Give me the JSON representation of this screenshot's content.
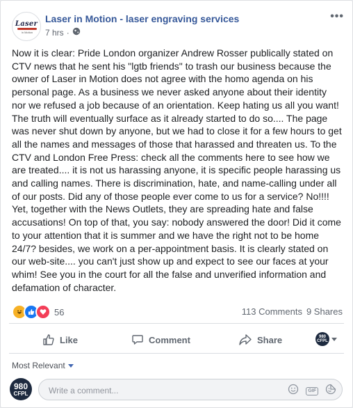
{
  "header": {
    "page_name": "Laser in Motion - laser engraving services",
    "timestamp": "7 hrs",
    "separator": "·",
    "logo_text": "Laser",
    "logo_sub": "in Motion",
    "privacy_icon": "globe-icon",
    "more_icon": "ellipsis-icon",
    "more_label": "•••"
  },
  "post": {
    "text": "Now it is clear: Pride London organizer Andrew Rosser publically stated on CTV news that he sent his \"lgtb friends\" to trash our business because the owner of Laser in Motion does not agree with the homo agenda on his personal page. As a business we never asked anyone about their identity nor we refused a job because of an orientation. Keep hating us all you want! The truth will eventually surface as it already started to do so.... The page was never shut down by anyone, but we had to close it for a few hours to get all the names and messages of those that harassed and threaten us. To the CTV and London Free Press: check all the comments here to see how we are treated.... it is not us harassing anyone, it is specific people harassing us and calling names. There is discrimination, hate, and name-calling under all of our posts. Did any of those people ever come to us for a service? No!!!! Yet, together with the News Outlets, they are spreading hate and false accusations! On top of that, you say: nobody answered the door! Did it come to your attention that it is summer and we have the right not to be home 24/7? besides, we work on a per-appointment basis. It is clearly stated on our web-site.... you can't just show up and expect to see our faces at your whim! See you in the court for all the false and unverified information and defamation of character."
  },
  "reactions": {
    "count": "56",
    "types": [
      "haha-icon",
      "like-icon",
      "love-icon"
    ],
    "comments": "113 Comments",
    "shares": "9 Shares"
  },
  "actions": {
    "like": "Like",
    "comment": "Comment",
    "share": "Share",
    "page_badge_line1": "980",
    "page_badge_line2": "CFPL"
  },
  "comments": {
    "sort_label": "Most Relevant",
    "avatar_line1": "980",
    "avatar_line2": "CFPL",
    "placeholder": "Write a comment...",
    "icons": [
      "emoji-icon",
      "gif-icon",
      "sticker-icon"
    ],
    "gif_label": "GIF"
  },
  "colors": {
    "link": "#365899",
    "accent": "#1877f2",
    "muted": "#606770",
    "love": "#f33e58",
    "haha": "#f7b125"
  }
}
